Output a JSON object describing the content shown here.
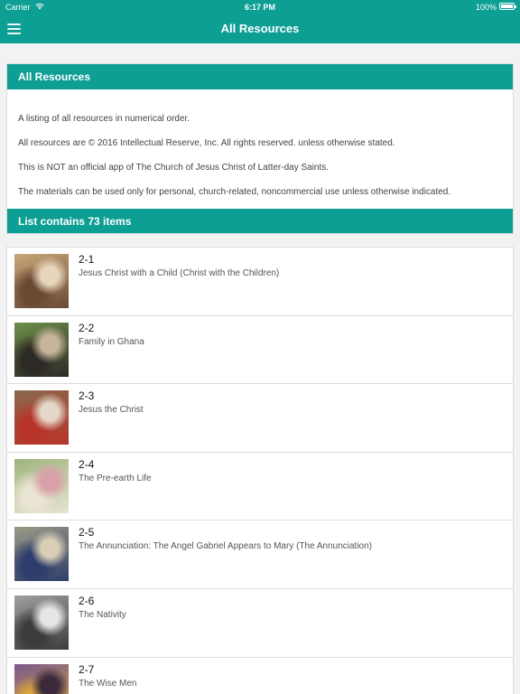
{
  "status": {
    "carrier": "Carrier",
    "time": "6:17 PM",
    "battery": "100%"
  },
  "nav": {
    "title": "All Resources"
  },
  "card": {
    "header": "All Resources",
    "paragraphs": [
      "A listing of all resources in numerical order.",
      "All resources are © 2016 Intellectual Reserve, Inc. All rights reserved. unless otherwise stated.",
      "This is NOT an official app of The Church of Jesus Christ of Latter-day Saints.",
      "The materials can be used only for personal, church-related, noncommercial use unless otherwise indicated."
    ],
    "footer": "List contains 73 items"
  },
  "items": [
    {
      "number": "2-1",
      "title": "Jesus Christ with a Child (Christ with the Children)",
      "thumb_colors": [
        "#c9a77b",
        "#6b4a33",
        "#e8d6bc"
      ]
    },
    {
      "number": "2-2",
      "title": "Family in Ghana",
      "thumb_colors": [
        "#6e8f4a",
        "#2d2a26",
        "#c8b49a"
      ]
    },
    {
      "number": "2-3",
      "title": "Jesus the Christ",
      "thumb_colors": [
        "#8a6a4c",
        "#b8342a",
        "#e6d8c8"
      ]
    },
    {
      "number": "2-4",
      "title": "The Pre-earth Life",
      "thumb_colors": [
        "#9db57c",
        "#e8e3d2",
        "#d9a0a8"
      ]
    },
    {
      "number": "2-5",
      "title": "The Annunciation: The Angel Gabriel Appears to Mary (The Annunciation)",
      "thumb_colors": [
        "#9c9a85",
        "#2e3d6b",
        "#d9cfb7"
      ]
    },
    {
      "number": "2-6",
      "title": "The Nativity",
      "thumb_colors": [
        "#a0a0a0",
        "#3c3c3c",
        "#e6e6e6"
      ]
    },
    {
      "number": "2-7",
      "title": "The Wise Men",
      "thumb_colors": [
        "#7a5a8a",
        "#d9a23c",
        "#3a2a3a"
      ]
    }
  ]
}
